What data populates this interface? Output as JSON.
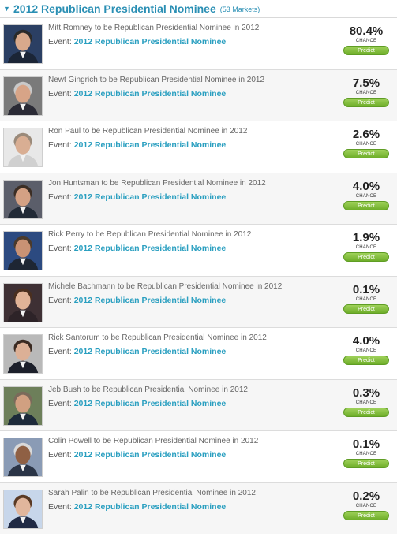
{
  "header": {
    "toggle_icon": "triangle-down",
    "title": "2012 Republican Presidential Nominee",
    "count": "(53 Markets)"
  },
  "colors": {
    "accent": "#2a8fb4",
    "predict": "#7cb834"
  },
  "markets": [
    {
      "market": "Mitt Romney to be Republican Presidential Nominee in 2012",
      "event_label": "Event:",
      "event": "2012 Republican Presidential Nominee",
      "chance": "80.4%",
      "chance_label": "CHANCE",
      "button": "Predict",
      "photo": "portrait-romney"
    },
    {
      "market": "Newt Gingrich to be Republican Presidential Nominee in 2012",
      "event_label": "Event:",
      "event": "2012 Republican Presidential Nominee",
      "chance": "7.5%",
      "chance_label": "CHANCE",
      "button": "Predict",
      "photo": "portrait-gingrich"
    },
    {
      "market": "Ron Paul to be Republican Presidential Nominee in 2012",
      "event_label": "Event:",
      "event": "2012 Republican Presidential Nominee",
      "chance": "2.6%",
      "chance_label": "CHANCE",
      "button": "Predict",
      "photo": "portrait-paul"
    },
    {
      "market": "Jon Huntsman to be Republican Presidential Nominee in 2012",
      "event_label": "Event:",
      "event": "2012 Republican Presidential Nominee",
      "chance": "4.0%",
      "chance_label": "CHANCE",
      "button": "Predict",
      "photo": "portrait-huntsman"
    },
    {
      "market": "Rick Perry to be Republican Presidential Nominee in 2012",
      "event_label": "Event:",
      "event": "2012 Republican Presidential Nominee",
      "chance": "1.9%",
      "chance_label": "CHANCE",
      "button": "Predict",
      "photo": "portrait-perry"
    },
    {
      "market": "Michele Bachmann to be Republican Presidential Nominee in 2012",
      "event_label": "Event:",
      "event": "2012 Republican Presidential Nominee",
      "chance": "0.1%",
      "chance_label": "CHANCE",
      "button": "Predict",
      "photo": "portrait-bachmann"
    },
    {
      "market": "Rick Santorum to be Republican Presidential Nominee in 2012",
      "event_label": "Event:",
      "event": "2012 Republican Presidential Nominee",
      "chance": "4.0%",
      "chance_label": "CHANCE",
      "button": "Predict",
      "photo": "portrait-santorum"
    },
    {
      "market": "Jeb Bush to be Republican Presidential Nominee in 2012",
      "event_label": "Event:",
      "event": "2012 Republican Presidential Nominee",
      "chance": "0.3%",
      "chance_label": "CHANCE",
      "button": "Predict",
      "photo": "portrait-bush"
    },
    {
      "market": "Colin Powell to be Republican Presidential Nominee in 2012",
      "event_label": "Event:",
      "event": "2012 Republican Presidential Nominee",
      "chance": "0.1%",
      "chance_label": "CHANCE",
      "button": "Predict",
      "photo": "portrait-powell"
    },
    {
      "market": "Sarah Palin to be Republican Presidential Nominee in 2012",
      "event_label": "Event:",
      "event": "2012 Republican Presidential Nominee",
      "chance": "0.2%",
      "chance_label": "CHANCE",
      "button": "Predict",
      "photo": "portrait-palin"
    }
  ]
}
